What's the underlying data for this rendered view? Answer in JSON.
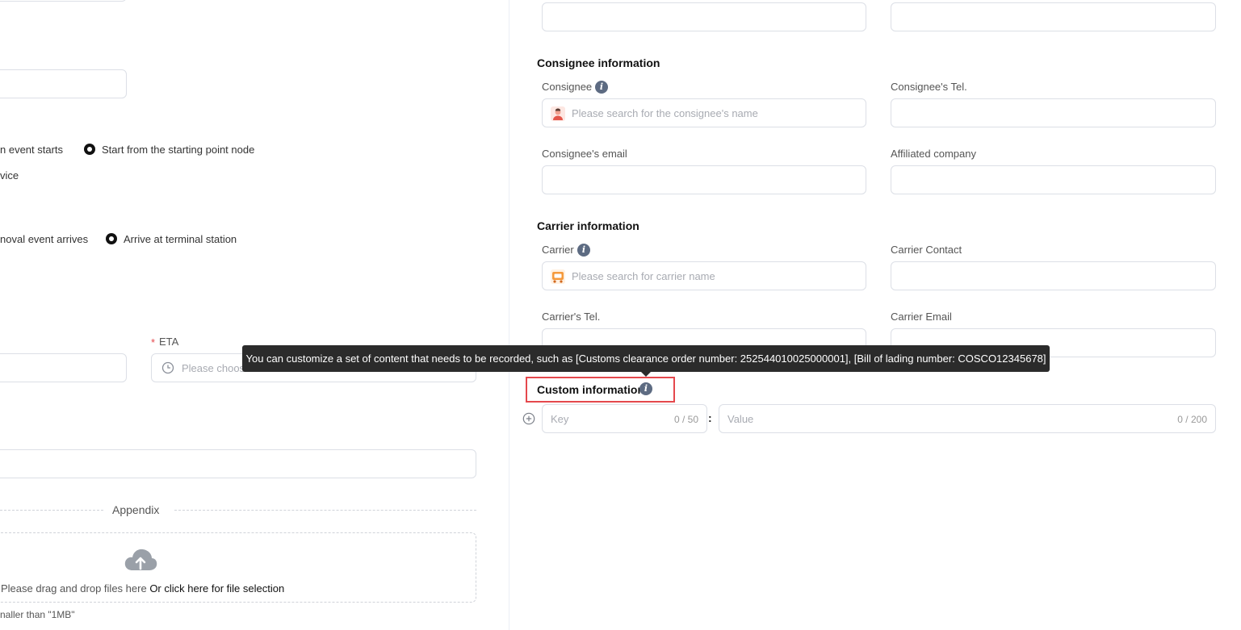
{
  "left": {
    "event_option_1": "n event starts",
    "event_option_2": "Start from the starting point node",
    "service_text": "vice",
    "removal_option_1": "noval event arrives",
    "removal_option_2": "Arrive at terminal station",
    "eta_required_mark": "*",
    "eta_label": "ETA",
    "eta_placeholder": "Please choose",
    "appendix_label": "Appendix",
    "upload_text": "Please drag and drop files here",
    "upload_link": "Or click here for file selection",
    "upload_hint": "naller than \"1MB\""
  },
  "consignee": {
    "section_title": "Consignee information",
    "consignee_label": "Consignee",
    "consignee_placeholder": "Please search for the consignee's name",
    "tel_label": "Consignee's Tel.",
    "email_label": "Consignee's email",
    "company_label": "Affiliated company"
  },
  "carrier": {
    "section_title": "Carrier information",
    "carrier_label": "Carrier",
    "carrier_placeholder": "Please search for carrier name",
    "contact_label": "Carrier Contact",
    "tel_label": "Carrier's Tel.",
    "email_label": "Carrier Email"
  },
  "custom": {
    "section_title": "Custom information",
    "tooltip": "You can customize a set of content that needs to be recorded, such as [Customs clearance order number: 252544010025000001], [Bill of lading number: COSCO12345678]",
    "key_placeholder": "Key",
    "key_counter": "0 / 50",
    "separator": ":",
    "value_placeholder": "Value",
    "value_counter": "0 / 200"
  },
  "icons": {
    "info": "info-icon",
    "person": "person-avatar-icon",
    "truck": "truck-icon",
    "clock": "clock-icon",
    "upload": "cloud-upload-icon",
    "add": "add-circle-icon"
  },
  "colors": {
    "highlight_border": "#e5484d",
    "tooltip_bg": "#2b2b2b",
    "required": "#e5484d"
  }
}
